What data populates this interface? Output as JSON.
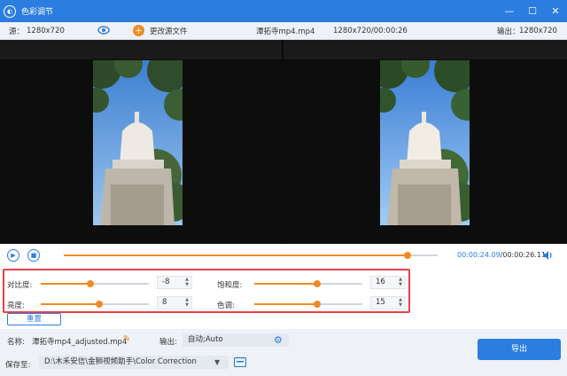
{
  "window": {
    "title": "色彩调节",
    "minimize": "—",
    "maximize": "☐",
    "close": "✕"
  },
  "infobar": {
    "source_label": "源：",
    "source_res": "1280x720",
    "change_source": "更改源文件",
    "filename": "潭拓寺mp4.mp4",
    "file_info": "1280x720/00:00:26",
    "output_label": "输出：",
    "output_res": "1280x720"
  },
  "playback": {
    "current_time": "00:00:24.09",
    "total_time": "00:00:26.11",
    "progress": 0.92
  },
  "adjust": {
    "contrast": {
      "label": "对比度:",
      "value": "-8",
      "level": 0.46
    },
    "saturation": {
      "label": "饱和度:",
      "value": "16",
      "level": 0.58
    },
    "brightness": {
      "label": "亮度:",
      "value": "8",
      "level": 0.54
    },
    "hue": {
      "label": "色调:",
      "value": "15",
      "level": 0.58
    },
    "reset": "重置"
  },
  "bottom": {
    "name_label": "名称:",
    "name_value": "潭拓寺mp4_adjusted.mp4",
    "output_label": "输出:",
    "output_value": "自动;Auto",
    "save_label": "保存至:",
    "save_path": "D:\\木禾安信\\金狮视频助手\\Color Correction",
    "export": "导出"
  },
  "colors": {
    "accent": "#2b7de0",
    "slider": "#f08a24",
    "highlight": "#e8404a"
  }
}
